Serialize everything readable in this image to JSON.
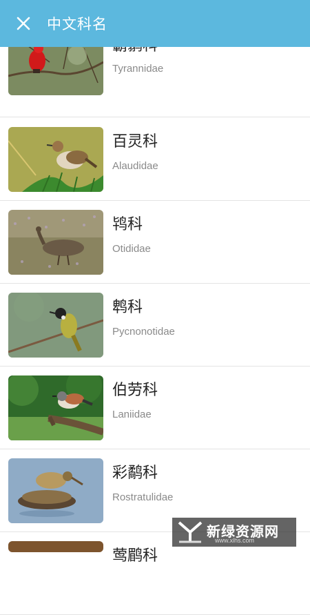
{
  "header": {
    "title": "中文科名",
    "background": "#5cb8de"
  },
  "families": [
    {
      "chinese": "霸鹟科",
      "latin": "Tyrannidae"
    },
    {
      "chinese": "百灵科",
      "latin": "Alaudidae"
    },
    {
      "chinese": "鸨科",
      "latin": "Otididae"
    },
    {
      "chinese": "鹎科",
      "latin": "Pycnonotidae"
    },
    {
      "chinese": "伯劳科",
      "latin": "Laniidae"
    },
    {
      "chinese": "彩鹬科",
      "latin": "Rostratulidae"
    },
    {
      "chinese": "莺鹛科",
      "latin": ""
    }
  ],
  "watermark": {
    "text": "新绿资源网",
    "subtext": "www.xlhs.com"
  }
}
